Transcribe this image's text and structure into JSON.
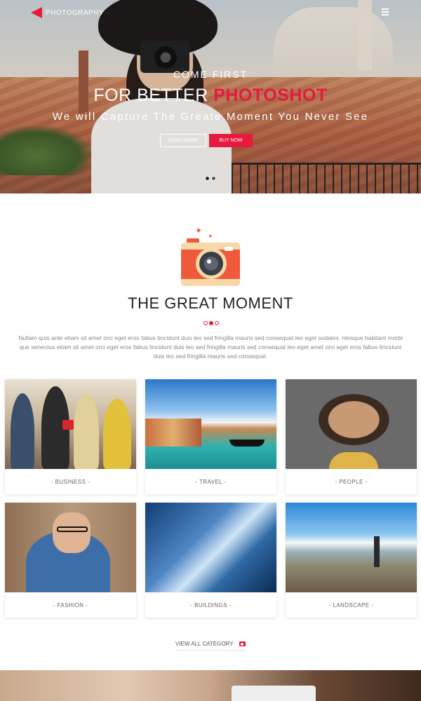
{
  "brand": {
    "name": "PHOTOGRAPHY",
    "mark": "i"
  },
  "hero": {
    "subtitle": "COME FIRST",
    "title_pre": "FOR BETTER ",
    "title_accent": "PHOTOSHOT",
    "tagline": "We will Capture The Greate Moment You Never See",
    "read_more": "READ MORE",
    "buy_now": "BUY NOW",
    "slides": 2,
    "active_slide": 1
  },
  "section": {
    "title": "THE GREAT MOMENT",
    "text": "Nullam quis ante etiam sit amet orci eget eros fabus tincidunt duis leo sed fringilla mauris sed consequat leo eget sodales. ntesque habitant morbi que senectus etiam sit amet orci eget eros fabus tincidunt duis leo sed fringilla mauris sed consequat leo eget amet orci eget eros fabus tincidunt duis leo sed fringilla mauris sed consequat."
  },
  "categories": [
    {
      "label": "- BUSINESS -"
    },
    {
      "label": "- TRAVEL -"
    },
    {
      "label": "- PEOPLE -"
    },
    {
      "label": "- FASHION -"
    },
    {
      "label": "- BUILDINGS -"
    },
    {
      "label": "- LANDSCAPE -"
    }
  ],
  "view_all": "VIEW ALL CATEGORY",
  "colors": {
    "accent": "#e8193c",
    "camera_body": "#ef5a3c",
    "camera_trim": "#f7d9a8"
  }
}
